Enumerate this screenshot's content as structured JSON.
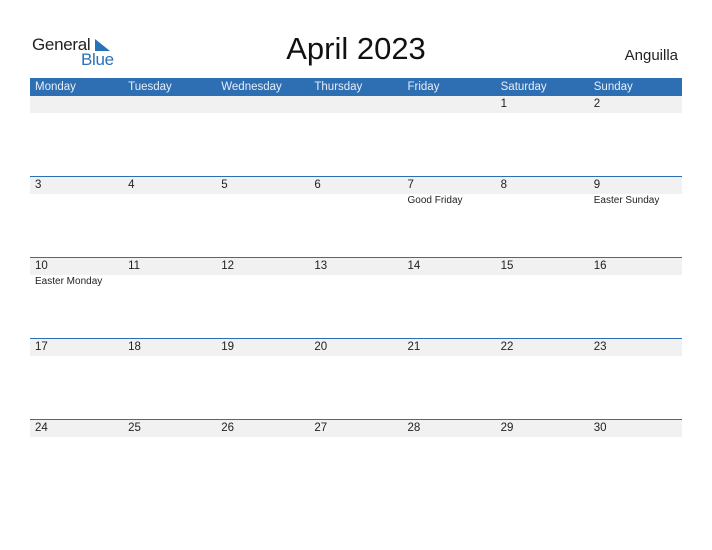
{
  "logo": {
    "word1": "General",
    "word2": "Blue",
    "accent_color": "#2a72b8"
  },
  "title": "April 2023",
  "country": "Anguilla",
  "header_color": "#2e6fb3",
  "weekdays": [
    "Monday",
    "Tuesday",
    "Wednesday",
    "Thursday",
    "Friday",
    "Saturday",
    "Sunday"
  ],
  "weeks": [
    [
      {
        "day": ""
      },
      {
        "day": ""
      },
      {
        "day": ""
      },
      {
        "day": ""
      },
      {
        "day": ""
      },
      {
        "day": "1"
      },
      {
        "day": "2"
      }
    ],
    [
      {
        "day": "3"
      },
      {
        "day": "4"
      },
      {
        "day": "5"
      },
      {
        "day": "6"
      },
      {
        "day": "7",
        "holiday": "Good Friday"
      },
      {
        "day": "8"
      },
      {
        "day": "9",
        "holiday": "Easter Sunday"
      }
    ],
    [
      {
        "day": "10",
        "holiday": "Easter Monday"
      },
      {
        "day": "11"
      },
      {
        "day": "12"
      },
      {
        "day": "13"
      },
      {
        "day": "14"
      },
      {
        "day": "15"
      },
      {
        "day": "16"
      }
    ],
    [
      {
        "day": "17"
      },
      {
        "day": "18"
      },
      {
        "day": "19"
      },
      {
        "day": "20"
      },
      {
        "day": "21"
      },
      {
        "day": "22"
      },
      {
        "day": "23"
      }
    ],
    [
      {
        "day": "24"
      },
      {
        "day": "25"
      },
      {
        "day": "26"
      },
      {
        "day": "27"
      },
      {
        "day": "28"
      },
      {
        "day": "29"
      },
      {
        "day": "30"
      }
    ]
  ]
}
